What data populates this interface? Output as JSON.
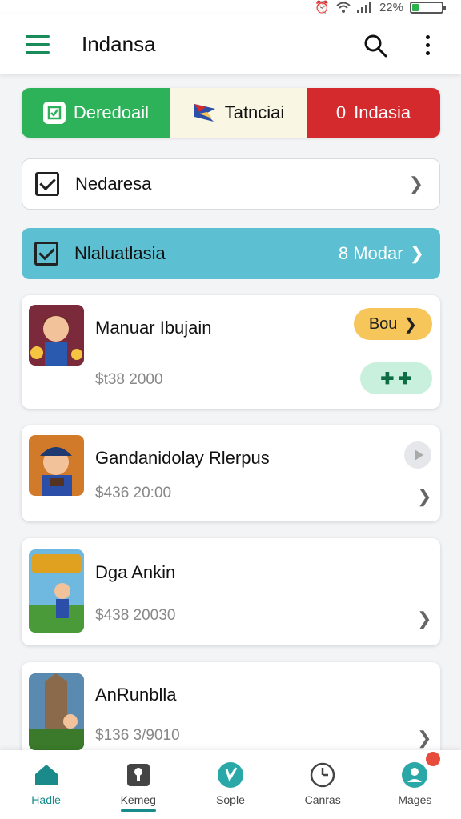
{
  "status_bar": {
    "battery_text": "22%",
    "battery_level": 0.22
  },
  "header": {
    "title": "Indansa"
  },
  "segments": [
    {
      "label": "Deredoail"
    },
    {
      "label": "Tatnciai"
    },
    {
      "label": "Indasia",
      "prefix": "0"
    }
  ],
  "rows": [
    {
      "label": "Nedaresa"
    },
    {
      "label": "Nlaluatlasia",
      "right_text": "8 Modar"
    }
  ],
  "games": [
    {
      "title": "Manuar Ibujain",
      "price": "$t38 2000",
      "badge": "Bou",
      "action": "✚ ✚"
    },
    {
      "title": "Gandanidolay Rlerpus",
      "price": "$436 20:00"
    },
    {
      "title": "Dga Ankin",
      "price": "$438 20030"
    },
    {
      "title": "AnRunblla",
      "price": "$136 3/9010"
    }
  ],
  "nav": [
    {
      "label": "Hadle",
      "icon": "home-icon"
    },
    {
      "label": "Kemeg",
      "icon": "keyhole-icon"
    },
    {
      "label": "Sople",
      "icon": "sprout-icon"
    },
    {
      "label": "Canras",
      "icon": "clock-icon"
    },
    {
      "label": "Mages",
      "icon": "profile-icon"
    }
  ],
  "colors": {
    "accent": "#1a8a8a",
    "green": "#2db25a",
    "red": "#d42a2e",
    "teal": "#5cc0d2",
    "yellow": "#f7c65a"
  }
}
